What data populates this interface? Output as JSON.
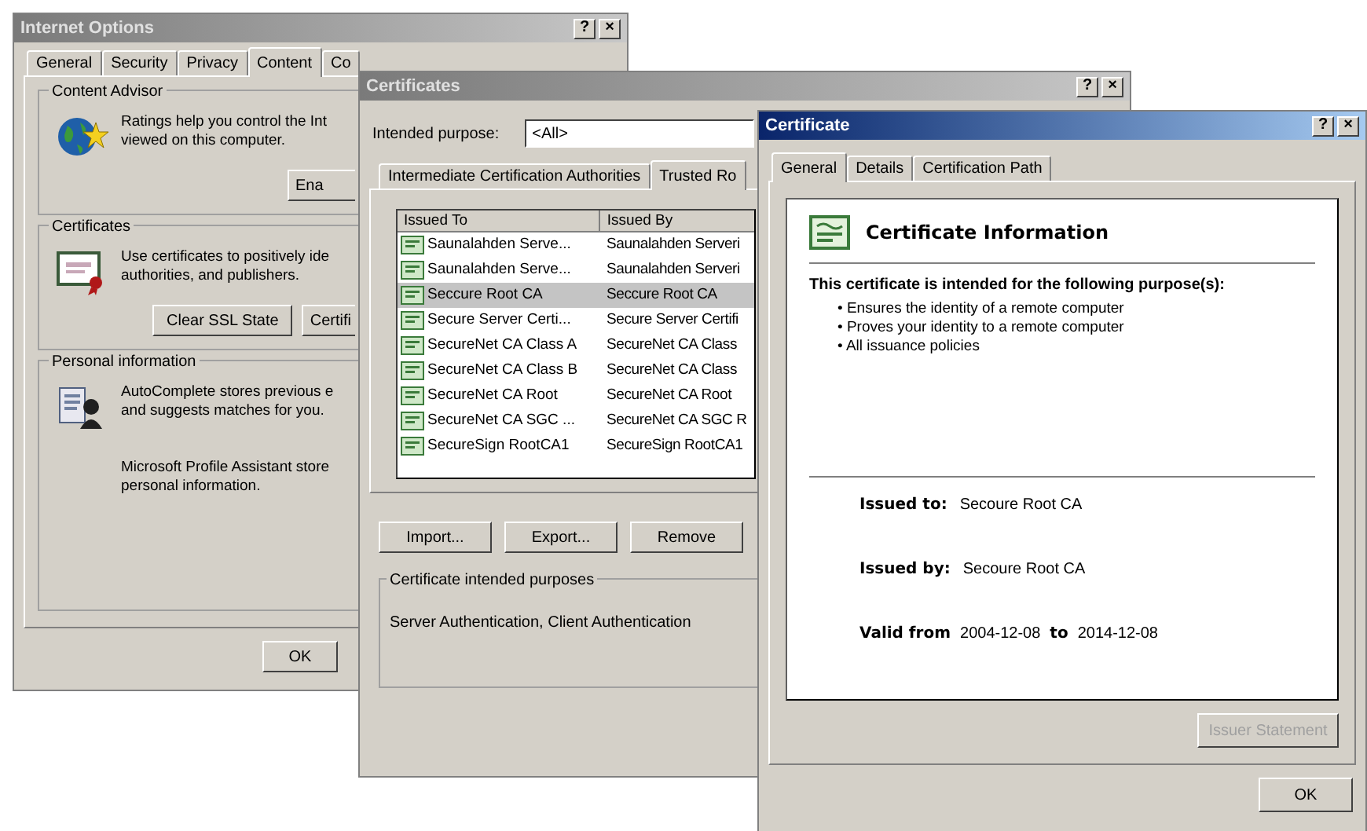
{
  "internet_options": {
    "title": "Internet Options",
    "active": false,
    "title_buttons": [
      "?",
      "×"
    ],
    "tabs": [
      {
        "label": "General",
        "selected": false
      },
      {
        "label": "Security",
        "selected": false
      },
      {
        "label": "Privacy",
        "selected": false
      },
      {
        "label": "Content",
        "selected": true
      },
      {
        "label": "Co",
        "selected": false
      }
    ],
    "groups": [
      {
        "kind": "content_advisor",
        "title": "Content Advisor",
        "paragraphs": [
          "Ratings help you control the Int\nviewed on this computer."
        ],
        "buttons": [
          "Ena"
        ]
      },
      {
        "kind": "certificates",
        "title": "Certificates",
        "paragraphs": [
          "Use certificates to positively ide\nauthorities, and publishers."
        ],
        "buttons": [
          "Clear SSL State",
          "Certifi"
        ]
      },
      {
        "kind": "personal",
        "title": "Personal information",
        "paragraphs": [
          "AutoComplete stores previous e\nand suggests matches for you.",
          "Microsoft Profile Assistant store\npersonal information."
        ]
      }
    ],
    "buttons": [
      "OK"
    ]
  },
  "certificates": {
    "title": "Certificates",
    "active": false,
    "title_buttons": [
      "?",
      "×"
    ],
    "purpose_label": "Intended purpose:",
    "purpose_value": "<All>",
    "tabs": [
      {
        "label": "Intermediate Certification Authorities",
        "selected": false
      },
      {
        "label": "Trusted Ro",
        "selected": true
      }
    ],
    "columns": [
      "Issued To",
      "Issued By"
    ],
    "rows": [
      {
        "issued_to": "Saunalahden Serve...",
        "issued_by": "Saunalahden Serveri",
        "selected": false
      },
      {
        "issued_to": "Saunalahden Serve...",
        "issued_by": "Saunalahden Serveri",
        "selected": false
      },
      {
        "issued_to": "Seccure Root CA",
        "issued_by": "Seccure Root CA",
        "selected": true
      },
      {
        "issued_to": "Secure Server Certi...",
        "issued_by": "Secure Server Certifi",
        "selected": false
      },
      {
        "issued_to": "SecureNet CA Class A",
        "issued_by": "SecureNet CA Class",
        "selected": false
      },
      {
        "issued_to": "SecureNet CA Class B",
        "issued_by": "SecureNet CA Class",
        "selected": false
      },
      {
        "issued_to": "SecureNet CA Root",
        "issued_by": "SecureNet CA Root",
        "selected": false
      },
      {
        "issued_to": "SecureNet CA SGC ...",
        "issued_by": "SecureNet CA SGC R",
        "selected": false
      },
      {
        "issued_to": "SecureSign RootCA1",
        "issued_by": "SecureSign RootCA1",
        "selected": false
      }
    ],
    "buttons": [
      "Import...",
      "Export...",
      "Remove"
    ],
    "purposes_group": {
      "title": "Certificate intended purposes",
      "text": "Server Authentication, Client Authentication"
    }
  },
  "certificate": {
    "title": "Certificate",
    "active": true,
    "title_buttons": [
      "?",
      "×"
    ],
    "tabs": [
      {
        "label": "General",
        "selected": true
      },
      {
        "label": "Details",
        "selected": false
      },
      {
        "label": "Certification Path",
        "selected": false
      }
    ],
    "heading": "Certificate Information",
    "purpose_intro": "This certificate is intended for the following purpose(s):",
    "purposes": [
      "• Ensures the identity of a remote computer",
      "• Proves your identity to a remote computer",
      "• All issuance policies"
    ],
    "fields": [
      {
        "label": "Issued to:",
        "value": "Secoure Root CA"
      },
      {
        "label": "Issued by:",
        "value": "Secoure Root CA"
      }
    ],
    "validity": {
      "label": "Valid from",
      "from": "2004-12-08",
      "to_label": "to",
      "to": "2014-12-08"
    },
    "issuer_button": {
      "label": "Issuer Statement",
      "disabled": true
    },
    "buttons": [
      "OK"
    ]
  }
}
